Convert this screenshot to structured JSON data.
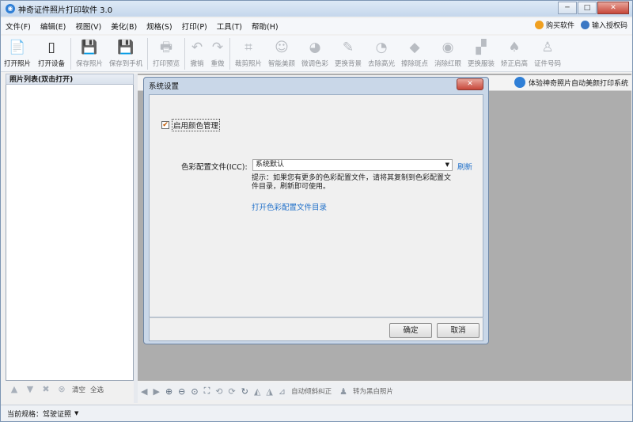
{
  "window": {
    "title": "神奇证件照片打印软件 3.0",
    "minimize": "─",
    "maximize": "□",
    "close": "✕"
  },
  "menu": {
    "items": [
      "文件(F)",
      "编辑(E)",
      "视图(V)",
      "美化(B)",
      "规格(S)",
      "打印(P)",
      "工具(T)",
      "帮助(H)"
    ],
    "buy": "购买软件",
    "license": "输入授权码"
  },
  "toolbar": {
    "items": [
      {
        "label": "打开照片",
        "icon": "open-photo-icon",
        "glyph": "📄"
      },
      {
        "label": "打开设备",
        "icon": "open-device-icon",
        "glyph": "▯"
      },
      {
        "label": "保存照片",
        "icon": "save-photo-icon",
        "glyph": "💾"
      },
      {
        "label": "保存到手机",
        "icon": "save-to-phone-icon",
        "glyph": "💾"
      },
      {
        "label": "打印预览",
        "icon": "print-preview-icon",
        "glyph": "🖶"
      },
      {
        "label": "撤销",
        "icon": "undo-icon",
        "glyph": "↶"
      },
      {
        "label": "重做",
        "icon": "redo-icon",
        "glyph": "↷"
      },
      {
        "label": "裁剪照片",
        "icon": "crop-icon",
        "glyph": "⌗"
      },
      {
        "label": "智能美颜",
        "icon": "beauty-icon",
        "glyph": "☺"
      },
      {
        "label": "微调色彩",
        "icon": "palette-icon",
        "glyph": "◕"
      },
      {
        "label": "更换背景",
        "icon": "brush-icon",
        "glyph": "✎"
      },
      {
        "label": "去除高光",
        "icon": "highlight-remove-icon",
        "glyph": "◔"
      },
      {
        "label": "擦除斑点",
        "icon": "eraser-icon",
        "glyph": "◆"
      },
      {
        "label": "消除红眼",
        "icon": "eye-icon",
        "glyph": "◉"
      },
      {
        "label": "更换服装",
        "icon": "clothes-icon",
        "glyph": "▞"
      },
      {
        "label": "矫正肩高",
        "icon": "shoulder-icon",
        "glyph": "♠"
      },
      {
        "label": "证件号码",
        "icon": "id-number-icon",
        "glyph": "♙"
      }
    ]
  },
  "left_panel": {
    "title": "照片列表(双击打开)",
    "clear": "清空",
    "select_all": "全选"
  },
  "banner": {
    "text": "体验神奇照片自动美颜打印系统"
  },
  "bottom_tools": {
    "auto_skew": "自动倾斜纠正",
    "to_bw": "转为黑白照片"
  },
  "status": {
    "label": "当前规格：驾驶证照"
  },
  "dialog": {
    "title": "系统设置",
    "close": "✕",
    "enable_color": "启用颜色管理",
    "checked": "✔",
    "icc_label": "色彩配置文件(ICC):",
    "icc_value": "系统默认",
    "refresh": "刷新",
    "hint": "提示：如果您有更多的色彩配置文件，请将其复制到色彩配置文件目录，刷新即可使用。",
    "open_dir": "打开色彩配置文件目录",
    "ok": "确定",
    "cancel": "取消"
  },
  "colors": {
    "accent": "#2f7fd6",
    "link": "#1f6fc9",
    "close_red": "#c7473a"
  }
}
